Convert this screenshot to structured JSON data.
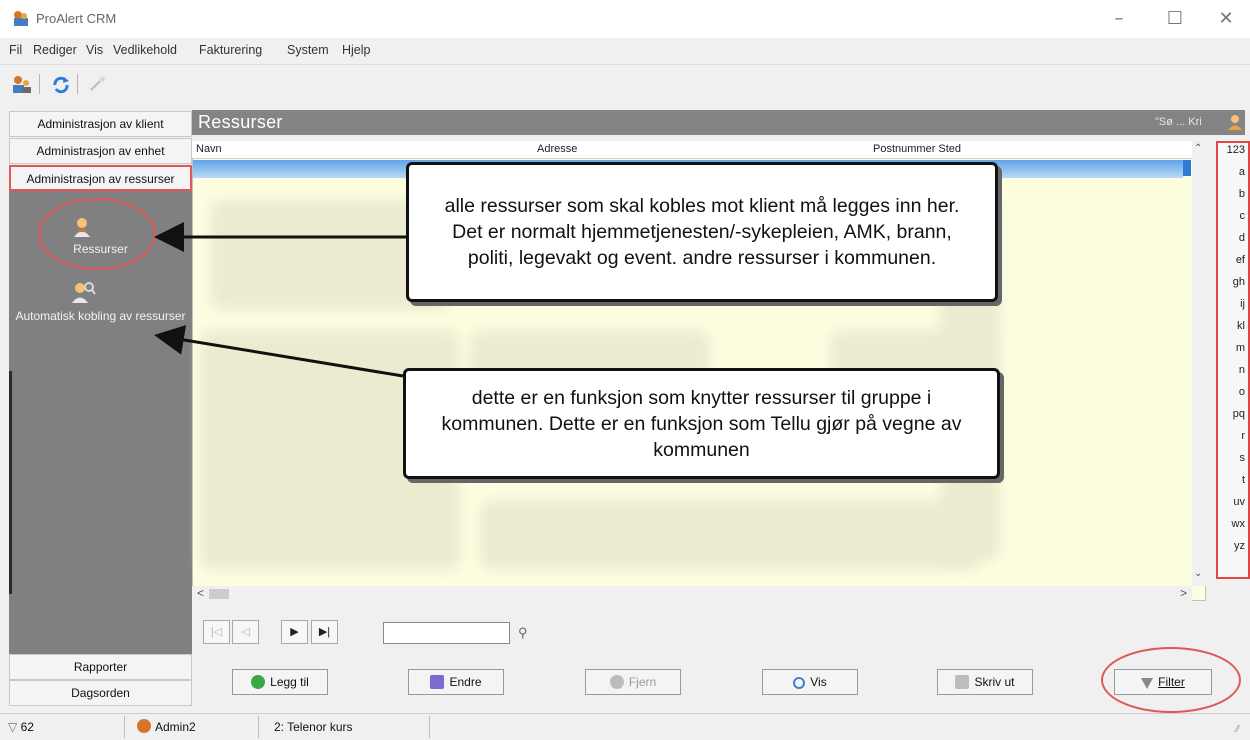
{
  "window": {
    "title": "ProAlert CRM"
  },
  "menu": [
    "Fil",
    "Rediger",
    "Vis",
    "Vedlikehold",
    "Fakturering",
    "System",
    "Hjelp"
  ],
  "nav": {
    "admin_klient": "Administrasjon av klient",
    "admin_enhet": "Administrasjon av enhet",
    "admin_ressurser": "Administrasjon av ressurser",
    "item_ressurser": "Ressurser",
    "item_kobling": "Automatisk kobling av ressurser",
    "rapporter": "Rapporter",
    "dagsorden": "Dagsorden"
  },
  "panel": {
    "title": "Ressurser",
    "search_hint": "\"Sø ... Kri"
  },
  "grid": {
    "columns": [
      "Navn",
      "Adresse",
      "Postnummer Sted"
    ]
  },
  "alphabet": [
    "123",
    "a",
    "b",
    "c",
    "d",
    "ef",
    "gh",
    "ij",
    "kl",
    "m",
    "n",
    "o",
    "pq",
    "r",
    "s",
    "t",
    "uv",
    "wx",
    "yz"
  ],
  "actions": {
    "legg_til": "Legg til",
    "endre": "Endre",
    "fjern": "Fjern",
    "vis": "Vis",
    "skriv_ut": "Skriv ut",
    "filter": "Filter"
  },
  "status": {
    "filter_count": "62",
    "user": "Admin2",
    "context": "2: Telenor kurs"
  },
  "callouts": {
    "top": "alle ressurser som skal kobles mot klient må legges inn her. Det er normalt hjemmetjenesten/-sykepleien, AMK, brann, politi, legevakt og event. andre ressurser i kommunen.",
    "bottom": "dette er en funksjon som knytter ressurser til gruppe i kommunen. Dette er en funksjon som Tellu gjør på vegne av kommunen"
  },
  "colors": {
    "highlight": "#e05757",
    "panel": "#808080",
    "grid_bg": "#fdfde0"
  }
}
